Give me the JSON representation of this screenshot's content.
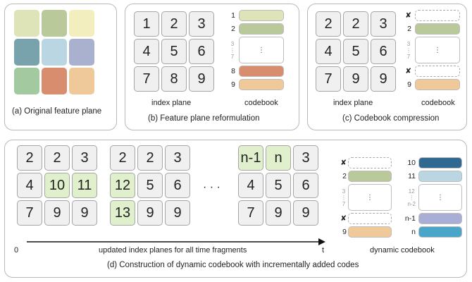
{
  "panel_a": {
    "caption": "(a) Original feature plane",
    "colors": [
      "#dfe3b8",
      "#b9c99a",
      "#f2eebd",
      "#78a3ac",
      "#b9d6e2",
      "#a9b1cf",
      "#a2c9a0",
      "#d88e6e",
      "#efc99a"
    ]
  },
  "panel_b": {
    "caption": "(b) Feature plane reformulation",
    "index_label": "index plane",
    "codebook_label": "codebook",
    "index_plane": [
      "1",
      "2",
      "3",
      "4",
      "5",
      "6",
      "7",
      "8",
      "9"
    ],
    "codebook_numbers": [
      "1",
      "2",
      "3",
      "7",
      "8",
      "9"
    ],
    "codebook_colors": [
      "#dfe3b8",
      "#b9c99a",
      "#d88e6e",
      "#efc99a"
    ],
    "dots": "⋮"
  },
  "panel_c": {
    "caption": "(c) Codebook compression",
    "index_label": "index plane",
    "codebook_label": "codebook",
    "index_plane": [
      "2",
      "2",
      "3",
      "4",
      "5",
      "6",
      "7",
      "9",
      "9"
    ],
    "codebook_numbers": [
      "2",
      "3",
      "7",
      "9"
    ],
    "codebook_colors": [
      "#b9c99a",
      "#efc99a"
    ],
    "removed_mark": "✘",
    "dots": "⋮"
  },
  "panel_d": {
    "caption": "(d) Construction of dynamic codebook with incrementally added codes",
    "plane1": [
      "2",
      "2",
      "3",
      "4",
      "10",
      "11",
      "7",
      "9",
      "9"
    ],
    "plane2": [
      "2",
      "2",
      "3",
      "12",
      "5",
      "6",
      "13",
      "9",
      "9"
    ],
    "plane3": [
      "n-1",
      "n",
      "3",
      "4",
      "5",
      "6",
      "7",
      "9",
      "9"
    ],
    "ellipsis": "· · ·",
    "axis_start": "0",
    "axis_end": "t",
    "axis_label": "updated index planes for all time fragments",
    "codebook_label": "dynamic codebook",
    "left_numbers": [
      "2",
      "3",
      "7",
      "9"
    ],
    "right_numbers": [
      "10",
      "11",
      "12",
      "n-2",
      "n-1",
      "n"
    ],
    "left_colors": [
      "#b9c99a",
      "#efc99a"
    ],
    "right_colors": [
      "#2f6890",
      "#b9d6e2",
      "#a9aed6",
      "#4aa6c8"
    ],
    "removed_mark": "✘",
    "dots": "⋮"
  }
}
